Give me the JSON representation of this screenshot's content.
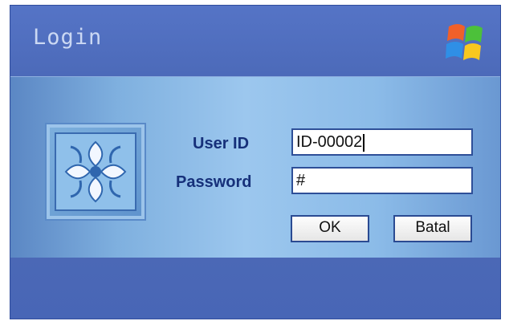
{
  "window": {
    "title": "Login"
  },
  "form": {
    "userid_label": "User ID",
    "password_label": "Password",
    "userid_value": "ID-00002",
    "password_value": "#",
    "ok_label": "OK",
    "cancel_label": "Batal"
  },
  "icons": {
    "logo": "windows-logo-icon",
    "emblem": "ornament-emblem-icon"
  },
  "colors": {
    "header": "#4f6fbf",
    "panel_light": "#9cc7ee",
    "label_text": "#16307a"
  }
}
